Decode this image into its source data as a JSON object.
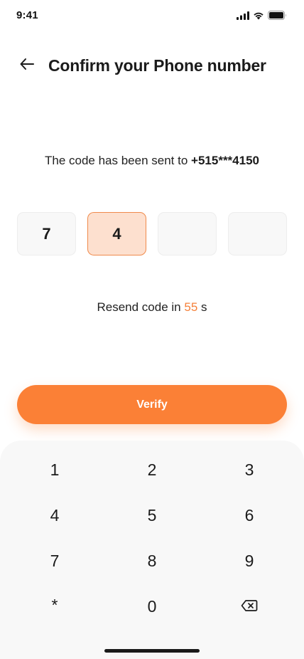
{
  "status_bar": {
    "time": "9:41"
  },
  "header": {
    "title": "Confirm your Phone number"
  },
  "message": {
    "prefix": "The code has been sent to",
    "phone": "+515***4150"
  },
  "otp": {
    "digits": [
      "7",
      "4",
      "",
      ""
    ],
    "active_index": 1
  },
  "resend": {
    "prefix": "Resend code in",
    "seconds": "55",
    "suffix": "s"
  },
  "verify_button": {
    "label": "Verify"
  },
  "keypad": {
    "keys": [
      "1",
      "2",
      "3",
      "4",
      "5",
      "6",
      "7",
      "8",
      "9",
      "*",
      "0"
    ],
    "backspace_icon": "backspace-icon"
  },
  "colors": {
    "accent": "#fb8036",
    "active_box_fill": "#fde0cf",
    "active_box_border": "#f08a4b",
    "keypad_bg": "#f8f8f8"
  }
}
